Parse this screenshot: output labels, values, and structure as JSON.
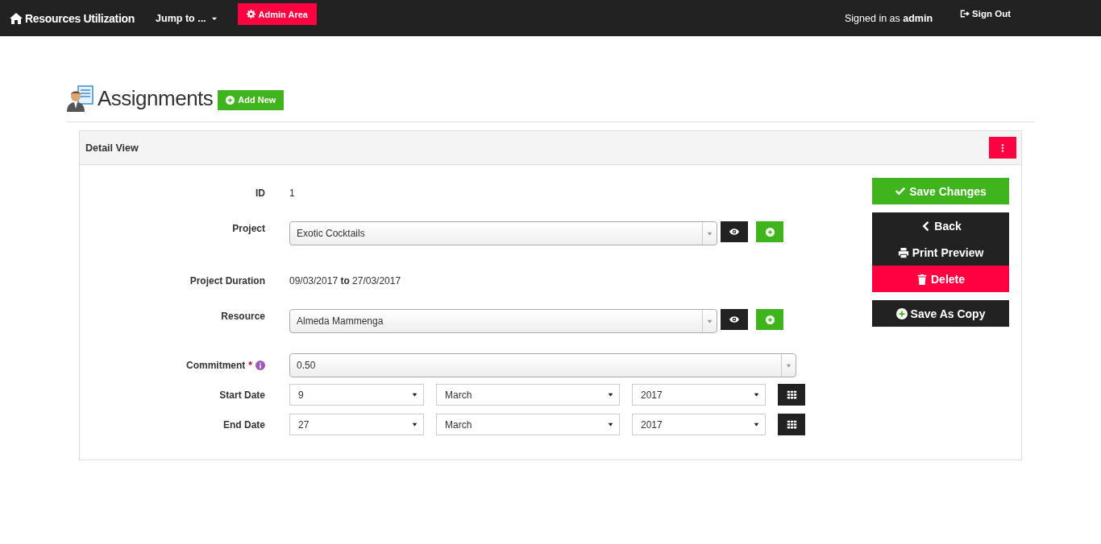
{
  "navbar": {
    "brand": "Resources Utilization",
    "jump_menu": "Jump to ...",
    "admin_button": "Admin Area",
    "signed_in": "Signed in as **admin**",
    "sign_out": "Sign Out"
  },
  "page": {
    "title": "Assignments",
    "add_new": "Add New"
  },
  "panel": {
    "title": "Detail View"
  },
  "fields": [
    {
      "kind": "text",
      "label": "ID",
      "value": "1"
    },
    {
      "kind": "lookup",
      "label": "Project",
      "value": "Exotic Cocktails"
    },
    {
      "kind": "text",
      "label": "Project Duration",
      "value": "09/03/2017 **to** 27/03/2017"
    },
    {
      "kind": "lookup",
      "label": "Resource",
      "value": "Almeda Mammenga"
    },
    {
      "kind": "select",
      "label": "Commitment",
      "required_mark": "*",
      "value": "0.50"
    },
    {
      "kind": "date",
      "label": "Start Date",
      "day": "9",
      "month": "March",
      "year": "2017"
    },
    {
      "kind": "date",
      "label": "End Date",
      "day": "27",
      "month": "March",
      "year": "2017"
    }
  ],
  "action_groups": [
    {
      "buttons": [
        {
          "label": "Save Changes",
          "kind": "save"
        }
      ]
    },
    {
      "buttons": [
        {
          "label": "Back",
          "kind": "back"
        },
        {
          "label": "Print Preview",
          "kind": "print"
        },
        {
          "label": "Delete",
          "kind": "delete"
        }
      ]
    },
    {
      "buttons": [
        {
          "label": "Save As Copy",
          "kind": "copy"
        }
      ]
    }
  ]
}
